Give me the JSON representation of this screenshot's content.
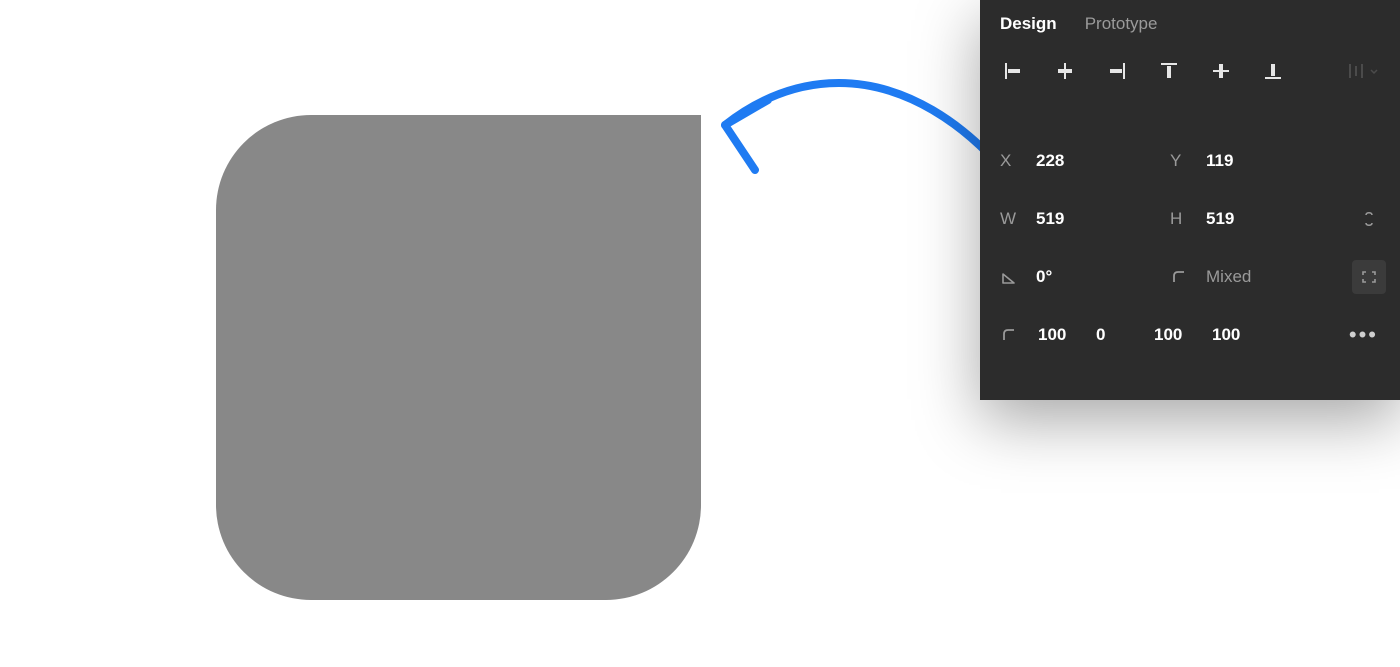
{
  "tabs": {
    "design": "Design",
    "prototype": "Prototype"
  },
  "position": {
    "x_label": "X",
    "x_value": "228",
    "y_label": "Y",
    "y_value": "119"
  },
  "size": {
    "w_label": "W",
    "w_value": "519",
    "h_label": "H",
    "h_value": "519"
  },
  "rotation": {
    "value": "0°"
  },
  "radius": {
    "value": "Mixed"
  },
  "corners": {
    "tl": "100",
    "tr": "0",
    "br": "100",
    "bl": "100"
  },
  "more": "•••",
  "shape": {
    "fill": "#888888",
    "radii": {
      "tl": 100,
      "tr": 0,
      "br": 100,
      "bl": 100
    }
  },
  "colors": {
    "panel_bg": "#2c2c2c",
    "arrow": "#1f7bf2"
  }
}
